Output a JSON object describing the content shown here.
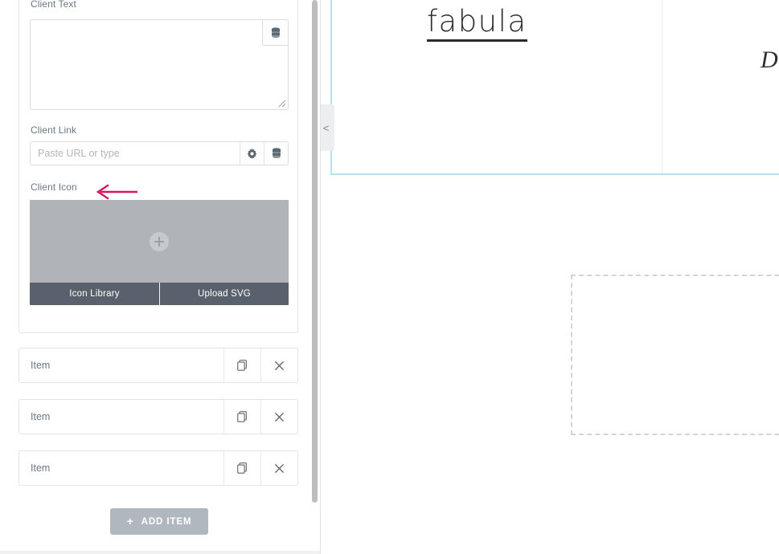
{
  "editor": {
    "repeater_item": {
      "fields": [
        {
          "label": "Client Text",
          "type": "textarea",
          "value": "",
          "placeholder": ""
        },
        {
          "label": "Client Link",
          "type": "url",
          "value": "",
          "placeholder": "Paste URL or type"
        },
        {
          "label": "Client Icon",
          "type": "icon",
          "value": "",
          "placeholder": ""
        }
      ],
      "text_field": {
        "label": "Client Text",
        "value": "",
        "placeholder": "",
        "dynamic_icon": "database-stack-icon"
      },
      "link_field": {
        "label": "Client Link",
        "value": "",
        "placeholder": "Paste URL or type",
        "settings_icon": "gear-icon",
        "dynamic_icon": "database-stack-icon"
      },
      "icon_field": {
        "label": "Client Icon",
        "upload_hint_icon": "plus-circle-icon",
        "buttons": [
          {
            "label": "Icon Library"
          },
          {
            "label": "Upload SVG"
          }
        ]
      },
      "annotation_arrow": {
        "target": "Client Icon",
        "direction": "left",
        "color": "#d6195e"
      }
    },
    "collapsed_items": [
      {
        "title": "Item",
        "duplicate_icon": "copy-icon",
        "remove_icon": "close-icon"
      },
      {
        "title": "Item",
        "duplicate_icon": "copy-icon",
        "remove_icon": "close-icon"
      },
      {
        "title": "Item",
        "duplicate_icon": "copy-icon",
        "remove_icon": "close-icon"
      }
    ],
    "add_item_button": {
      "label": "ADD ITEM",
      "icon": "plus-icon",
      "color": "#b0b7bf"
    },
    "scrollbar": {
      "position": "right",
      "thumb_color": "#bdbdbd"
    }
  },
  "canvas": {
    "collapse_handle": {
      "icon": "chevron-left-icon",
      "label": "<"
    },
    "selection_outline_color": "#b9e0ef",
    "brand_logo": {
      "text": "fabula",
      "underlined": true,
      "color": "#2b2b2b"
    },
    "text_fragment": {
      "text": "D",
      "style": "serif-italic"
    },
    "placeholder_box": {
      "style": "dashed",
      "color": "#d3d4d8"
    }
  }
}
